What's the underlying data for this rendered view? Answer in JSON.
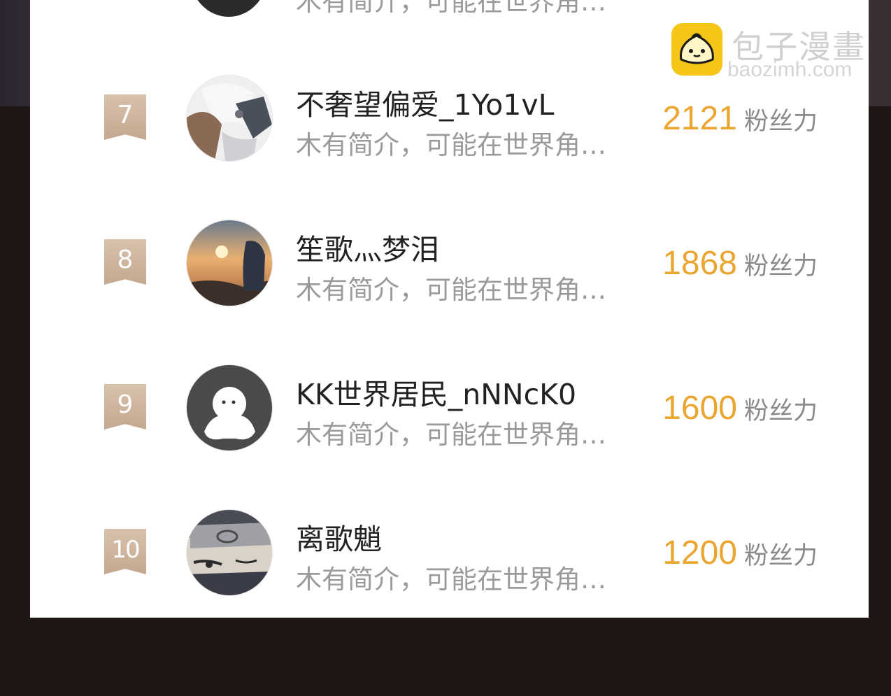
{
  "watermark": {
    "title": "包子漫畫",
    "url": "baozimh.com"
  },
  "previous_row": {
    "bio": "木有简介，可能在世界角…"
  },
  "rows": [
    {
      "rank": "7",
      "name": "不奢望偏爱_1Yo1vL",
      "bio": "木有简介，可能在世界角…",
      "score": "2121",
      "unit": "粉丝力"
    },
    {
      "rank": "8",
      "name": "笙歌灬梦泪",
      "bio": "木有简介，可能在世界角…",
      "score": "1868",
      "unit": "粉丝力"
    },
    {
      "rank": "9",
      "name": "KK世界居民_nNNcK0",
      "bio": "木有简介，可能在世界角…",
      "score": "1600",
      "unit": "粉丝力"
    },
    {
      "rank": "10",
      "name": "离歌魈",
      "bio": "木有简介，可能在世界角…",
      "score": "1200",
      "unit": "粉丝力"
    }
  ],
  "colors": {
    "score": "#eba531",
    "rank_badge": "#c9ae96",
    "background": "#1e1515"
  }
}
